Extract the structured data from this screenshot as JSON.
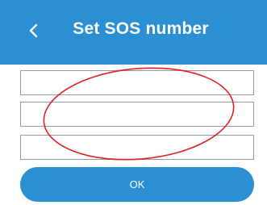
{
  "header": {
    "title": "Set SOS number",
    "back_icon": "chevron-left-icon"
  },
  "fields": [
    {
      "value": "",
      "placeholder": ""
    },
    {
      "value": "",
      "placeholder": ""
    },
    {
      "value": "",
      "placeholder": ""
    }
  ],
  "ok_button": {
    "label": "OK"
  },
  "annotation": {
    "shape": "ellipse",
    "color": "#e02020"
  },
  "colors": {
    "accent": "#2b8fd3",
    "field_border": "#9a9a9a",
    "background": "#ffffff"
  }
}
